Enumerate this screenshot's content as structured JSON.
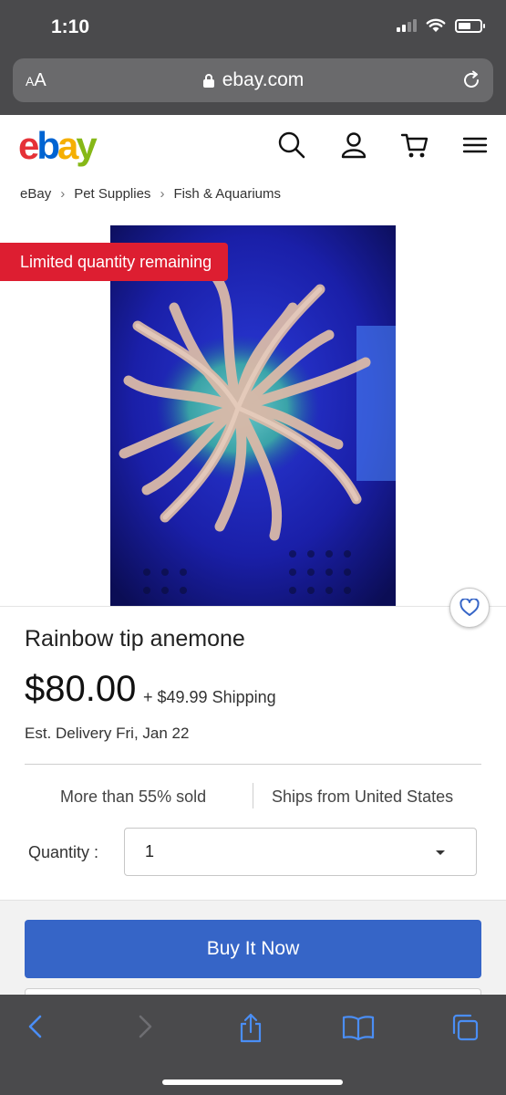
{
  "status_bar": {
    "time": "1:10"
  },
  "browser": {
    "text_size_label_small": "A",
    "text_size_label_large": "A",
    "url": "ebay.com"
  },
  "header": {
    "logo": {
      "e": "e",
      "b": "b",
      "a": "a",
      "y": "y"
    },
    "icons": [
      "search-icon",
      "user-icon",
      "cart-icon",
      "menu-icon"
    ]
  },
  "breadcrumb": [
    "eBay",
    "Pet Supplies",
    "Fish & Aquariums"
  ],
  "badge": "Limited quantity remaining",
  "product": {
    "title": "Rainbow tip anemone",
    "price": "$80.00",
    "shipping": "+ $49.99 Shipping",
    "delivery": "Est. Delivery Fri, Jan 22"
  },
  "stats": {
    "sold": "More than 55% sold",
    "ships_from": "Ships from United States"
  },
  "quantity": {
    "label": "Quantity :",
    "value": "1"
  },
  "cta": {
    "buy_now": "Buy It Now"
  },
  "colors": {
    "buy_button": "#3665c7",
    "badge": "#dd1e31",
    "chrome": "#4a4a4c",
    "toolbar_icon": "#4a8ef5"
  },
  "toolbar": [
    "back-icon",
    "forward-icon",
    "share-icon",
    "bookmarks-icon",
    "tabs-icon"
  ]
}
